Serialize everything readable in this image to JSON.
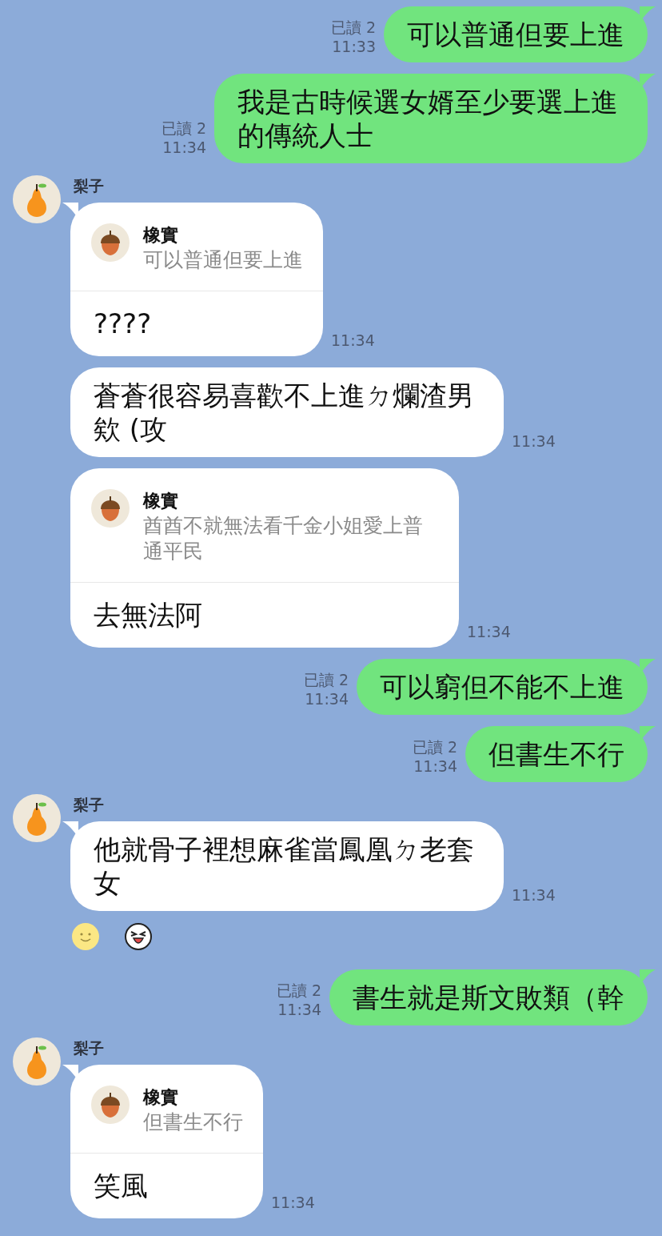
{
  "messages": [
    {
      "kind": "sent",
      "text": "可以普通但要上進",
      "read": "已讀 2",
      "time": "11:33"
    },
    {
      "kind": "sent",
      "text": "我是古時候選女婿至少要選上進的傳統人士",
      "read": "已讀 2",
      "time": "11:34"
    },
    {
      "kind": "received",
      "sender": "梨子",
      "reply": {
        "name": "橡實",
        "text": "可以普通但要上進"
      },
      "text": "????",
      "time": "11:34"
    },
    {
      "kind": "received",
      "text": "蒼蒼很容易喜歡不上進ㄉ爛渣男欸 (攻",
      "time": "11:34"
    },
    {
      "kind": "received",
      "reply": {
        "name": "橡實",
        "text": "酋酋不就無法看千金小姐愛上普通平民"
      },
      "text": "去無法阿",
      "time": "11:34"
    },
    {
      "kind": "sent",
      "text": "可以窮但不能不上進",
      "read": "已讀 2",
      "time": "11:34"
    },
    {
      "kind": "sent",
      "text": "但書生不行",
      "read": "已讀 2",
      "time": "11:34"
    },
    {
      "kind": "received",
      "sender": "梨子",
      "text": "他就骨子裡想麻雀當鳳凰ㄉ老套女",
      "time": "11:34",
      "reactions": true
    },
    {
      "kind": "sent",
      "text": "書生就是斯文敗類（幹",
      "read": "已讀 2",
      "time": "11:34"
    },
    {
      "kind": "received",
      "sender": "梨子",
      "reply": {
        "name": "橡實",
        "text": "但書生不行"
      },
      "text": "笑風",
      "time": "11:34"
    }
  ]
}
